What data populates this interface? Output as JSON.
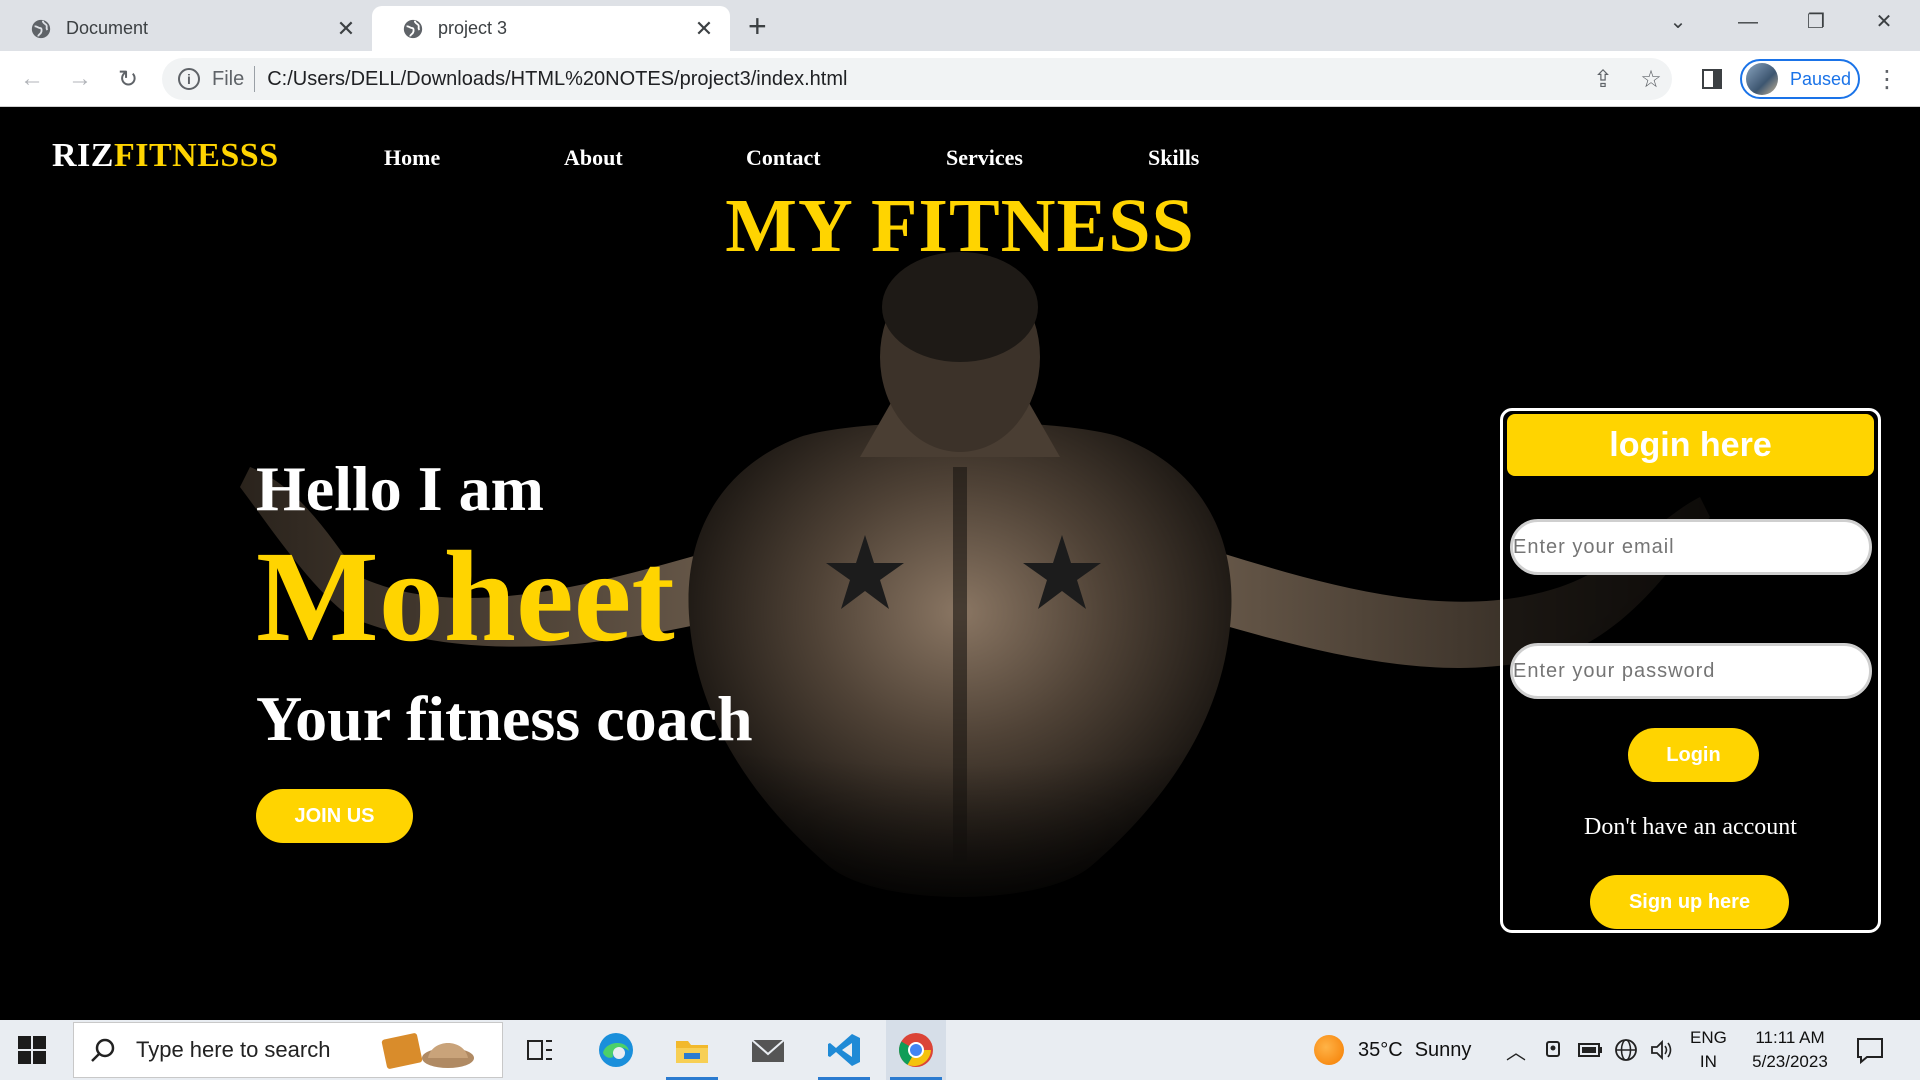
{
  "browser": {
    "tabs": [
      {
        "title": "Document",
        "icon": "globe-icon",
        "active": false
      },
      {
        "title": "project 3",
        "icon": "globe-icon",
        "active": true
      }
    ],
    "address": {
      "scheme": "File",
      "url": "C:/Users/DELL/Downloads/HTML%20NOTES/project3/index.html"
    },
    "profile_status": "Paused"
  },
  "site": {
    "logo_part1": "RIZ",
    "logo_part2": "FITNESSS",
    "nav": [
      "Home",
      "About",
      "Contact",
      "Services",
      "Skills"
    ],
    "title": "MY FITNESS",
    "hero": {
      "greeting": "Hello I am",
      "name": "Moheet",
      "tagline": "Your fitness coach",
      "cta": "JOIN US"
    },
    "login": {
      "heading": "login here",
      "email_placeholder": "Enter your email",
      "password_placeholder": "Enter your password",
      "login_button": "Login",
      "no_account_text": "Don't have an account",
      "signup_button": "Sign up here"
    },
    "colors": {
      "accent": "#ffd400",
      "background": "#000000",
      "text": "#ffffff"
    }
  },
  "taskbar": {
    "search_placeholder": "Type here to search",
    "weather": {
      "temp": "35°C",
      "condition": "Sunny"
    },
    "language": {
      "line1": "ENG",
      "line2": "IN"
    },
    "clock": {
      "time": "11:11 AM",
      "date": "5/23/2023"
    }
  }
}
